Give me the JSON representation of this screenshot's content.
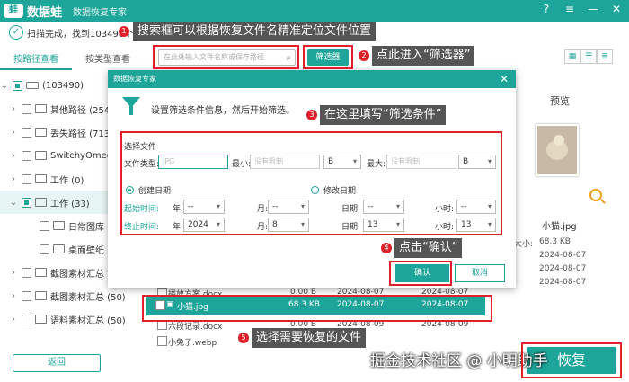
{
  "titlebar": {
    "logo": "蛙",
    "brand": "数据蛙",
    "subtitle": "数据恢复专家",
    "help": "?",
    "menu": "≡",
    "minimize": "—",
    "close": "✕"
  },
  "status": {
    "check": "✓",
    "text": "扫描完成，找到103490个"
  },
  "left_tabs": [
    "按路径查看",
    "按类型查看"
  ],
  "tree": [
    {
      "label": "(103490)",
      "expanded": true
    },
    {
      "label": "其他路径 (2545"
    },
    {
      "label": "丢失路径 (7139"
    },
    {
      "label": "SwitchyOmega"
    },
    {
      "label": "工作 (0)"
    },
    {
      "label": "工作 (33)",
      "expanded": true
    },
    {
      "label": "日常图库 (2"
    },
    {
      "label": "桌面壁纸 (1"
    },
    {
      "label": "截图素材汇总 (5"
    },
    {
      "label": "截图素材汇总 (50)"
    },
    {
      "label": "语料素材汇总 (50)"
    }
  ],
  "toolbar": {
    "search_placeholder": "在此处输入文件名称或保存路径",
    "filter_label": "筛选器",
    "view_icons": [
      "grid-icon",
      "list-icon",
      "detail-icon"
    ]
  },
  "dialog": {
    "title": "数据恢复专家",
    "close": "✕",
    "hint": "设置筛选条件信息，然后开始筛选。",
    "section_label": "选择文件",
    "file_type_label": "文件类型:",
    "file_type_placeholder": "JPG",
    "min_label": "最小:",
    "max_label": "最大:",
    "no_limit": "没有限制",
    "unit_b": "B",
    "created_label": "创建日期",
    "modified_label": "修改日期",
    "start_time_label": "起始时间:",
    "end_time_label": "终止时间:",
    "year_label": "年:",
    "month_label": "月:",
    "day_label": "日期:",
    "hour_label": "小时:",
    "dash": "--",
    "end_year": "2024",
    "end_month": "8",
    "end_day": "13",
    "end_hour": "13",
    "ok": "确认",
    "cancel": "取消"
  },
  "annotations": {
    "n1": "1",
    "c1": "搜索框可以根据恢复文件名精准定位文件位置",
    "n2": "2",
    "c2": "点此进入“筛选器”",
    "n3": "3",
    "c3": "在这里填写“筛选条件”",
    "n4": "4",
    "c4": "点击“确认”",
    "n5": "5",
    "c5": "选择需要恢复的文件"
  },
  "preview": {
    "title": "预览",
    "filename": "小猫.jpg",
    "size": "68.3 KB",
    "date1": "2024-08-07",
    "date2": "2024-08-07",
    "date3": "2024-08-07",
    "size_label": "大小:"
  },
  "file_list": [
    {
      "name": "播放方案.docx",
      "size": "0.00 B",
      "created": "2024-08-07",
      "modified": "2024-08-07"
    },
    {
      "name": "小猫.jpg",
      "size": "68.3 KB",
      "created": "2024-08-07",
      "modified": "2024-08-07"
    },
    {
      "name": "六段记录.docx",
      "size": "0.00 B",
      "created": "2024-08-09",
      "modified": "2024-08-09"
    },
    {
      "name": "小兔子.webp",
      "size": "",
      "created": "",
      "modified": ""
    }
  ],
  "bottom": {
    "back": "返回",
    "watermark": "掘金技术社区 @ 小明助手",
    "recover": "恢复"
  },
  "colors": {
    "accent": "#1ea59a",
    "annotation_red": "#e0202b"
  }
}
